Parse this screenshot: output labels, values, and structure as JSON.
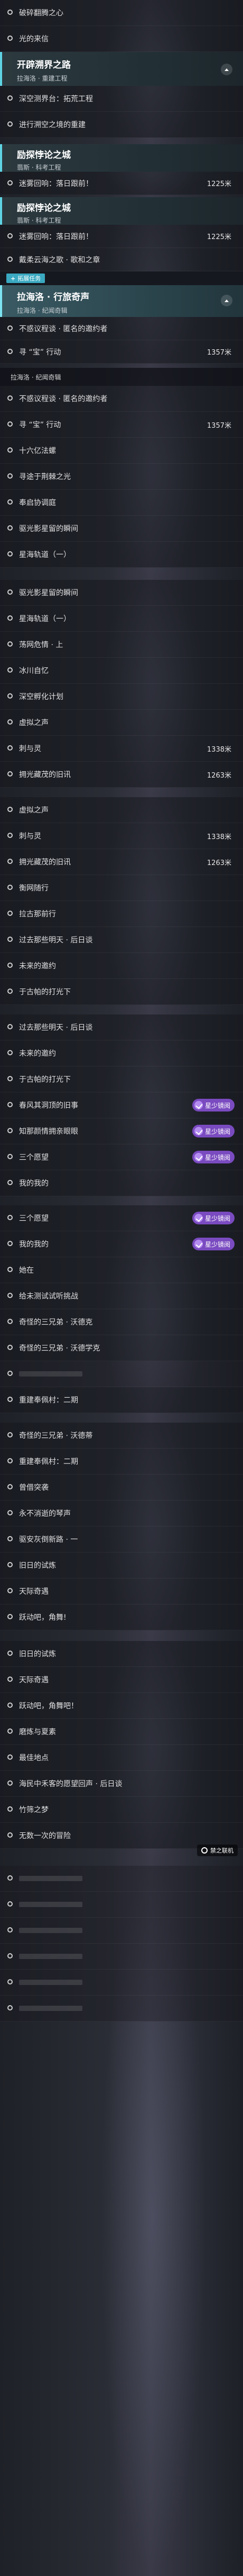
{
  "panel1": {
    "rows_top": [
      {
        "label": "破碎翻腾之心",
        "distance": ""
      },
      {
        "label": "光的来信",
        "distance": ""
      }
    ],
    "header": {
      "title": "开辟溯界之路",
      "subtitle": "拉海洛 · 重建工程"
    },
    "rows_bottom": [
      {
        "label": "深空测界台：拓荒工程",
        "distance": ""
      },
      {
        "label": "进行溯空之境的重建",
        "distance": ""
      }
    ]
  },
  "panel2": {
    "header": {
      "title": "励探悖论之城",
      "subtitle": "翡斯 · 科考工程"
    },
    "rows": [
      {
        "label": "迷雾回响：落日跟前！",
        "distance": "1225米"
      }
    ]
  },
  "panel3": {
    "header": {
      "title": "励探悖论之城",
      "subtitle": "翡斯 · 科考工程"
    },
    "rows": [
      {
        "label": "迷雾回响：落日跟前！",
        "distance": "1225米"
      },
      {
        "label": "戴柔云海之歌 · 歌和之章",
        "distance": ""
      }
    ],
    "tab": {
      "label": "拓展任务"
    },
    "active_header": {
      "title": "拉海洛 · 行旅奇声",
      "subtitle": "拉海洛 · 纪闻奇辑"
    },
    "rows_after": [
      {
        "label": "不惑议程谈 · 匿名的邀约者",
        "distance": ""
      },
      {
        "label": "寻 “宝” 行动",
        "distance": "1357米"
      }
    ]
  },
  "panel4": {
    "section": "拉海洛 · 纪闻奇辑",
    "rows": [
      {
        "label": "不惑议程谈 · 匿名的邀约者",
        "distance": ""
      },
      {
        "label": "寻 “宝” 行动",
        "distance": "1357米"
      },
      {
        "label": "十六亿法螺",
        "distance": ""
      },
      {
        "label": "寻途于荆棘之光",
        "distance": ""
      },
      {
        "label": "奉启协调庭",
        "distance": ""
      },
      {
        "label": "驱光影星留的瞬间",
        "distance": ""
      },
      {
        "label": "星海轨道（一）",
        "distance": ""
      }
    ]
  },
  "panel5": {
    "rows": [
      {
        "label": "驱光影星留的瞬间",
        "distance": ""
      },
      {
        "label": "星海轨道（一）",
        "distance": ""
      },
      {
        "label": "荡网危情 · 上",
        "distance": ""
      },
      {
        "label": "冰川自忆",
        "distance": ""
      },
      {
        "label": "深空孵化计划",
        "distance": ""
      },
      {
        "label": "虚拟之声",
        "distance": ""
      },
      {
        "label": "刺与灵",
        "distance": "1338米"
      },
      {
        "label": "拥光藏茂的旧讯",
        "distance": "1263米"
      }
    ]
  },
  "panel6": {
    "rows": [
      {
        "label": "虚拟之声",
        "distance": ""
      },
      {
        "label": "刺与灵",
        "distance": "1338米"
      },
      {
        "label": "拥光藏茂的旧讯",
        "distance": "1263米"
      },
      {
        "label": "衡网随行",
        "distance": ""
      },
      {
        "label": "拉古那前行",
        "distance": ""
      },
      {
        "label": "过去那些明天 · 后日谈",
        "distance": ""
      },
      {
        "label": "未来的邀约",
        "distance": ""
      },
      {
        "label": "于古帕的打光下",
        "distance": ""
      }
    ]
  },
  "panel7": {
    "badge_label": "星少镜阅",
    "rows": [
      {
        "label": "过去那些明天 · 后日谈",
        "distance": "",
        "badge": false
      },
      {
        "label": "未来的邀约",
        "distance": "",
        "badge": false
      },
      {
        "label": "于古帕的打光下",
        "distance": "",
        "badge": false
      },
      {
        "label": "春风其洞顶的旧事",
        "distance": "",
        "badge": true
      },
      {
        "label": "知那颜情拥亲眼眼",
        "distance": "",
        "badge": true
      },
      {
        "label": "三个愿望",
        "distance": "",
        "badge": true
      },
      {
        "label": "我的我的",
        "distance": "",
        "badge": false
      }
    ]
  },
  "panel8": {
    "badge_label": "星少镜阅",
    "rows": [
      {
        "label": "三个愿望",
        "distance": "",
        "badge": true
      },
      {
        "label": "我的我的",
        "distance": "",
        "badge": true
      },
      {
        "label": "她在",
        "distance": "",
        "badge": false
      },
      {
        "label": "给未测试试听挑战",
        "distance": "",
        "badge": false
      },
      {
        "label": "奇怪的三兄弟 · 沃德克",
        "distance": "",
        "badge": false
      },
      {
        "label": "奇怪的三兄弟 · 沃德学克",
        "distance": "",
        "badge": false
      },
      {
        "label": "",
        "distance": "",
        "badge": false
      },
      {
        "label": "重建奉佩村：二期",
        "distance": "",
        "badge": false
      }
    ]
  },
  "panel9": {
    "rows": [
      {
        "label": "奇怪的三兄弟 · 沃德蒂",
        "distance": ""
      },
      {
        "label": "重建奉佩村：二期",
        "distance": ""
      },
      {
        "label": "曾借突袭",
        "distance": ""
      },
      {
        "label": "永不消逝的琴声",
        "distance": ""
      },
      {
        "label": "驱安灰倒新路 · 一",
        "distance": ""
      },
      {
        "label": "旧日的试炼",
        "distance": ""
      },
      {
        "label": "天际奇遇",
        "distance": ""
      },
      {
        "label": "跃动吧，角舞!",
        "distance": ""
      }
    ]
  },
  "panel10": {
    "rows": [
      {
        "label": "旧日的试炼",
        "distance": ""
      },
      {
        "label": "天际奇遇",
        "distance": ""
      },
      {
        "label": "跃动吧，角舞吧！",
        "distance": ""
      },
      {
        "label": "磨炼与夏素",
        "distance": ""
      },
      {
        "label": "最佳地点",
        "distance": ""
      },
      {
        "label": "海民中禾客的愿望回声 · 后日谈",
        "distance": ""
      },
      {
        "label": "竹筛之梦",
        "distance": ""
      },
      {
        "label": "无数一次的冒险",
        "distance": ""
      }
    ],
    "corner_badge": "禁之联机"
  }
}
